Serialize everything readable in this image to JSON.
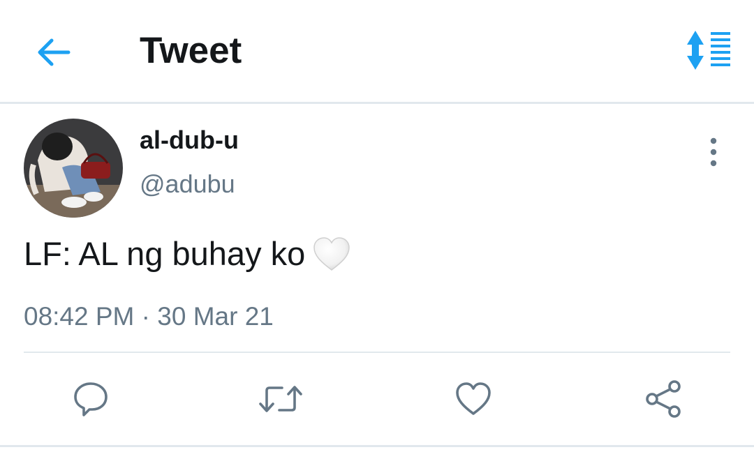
{
  "header": {
    "title": "Tweet",
    "back_icon": "arrow-left-icon",
    "sort_icon": "sort-list-icon",
    "accent_color": "#1da1f2"
  },
  "tweet": {
    "author": {
      "display_name": "al-dub-u",
      "handle": "@adubu",
      "avatar_icon": "avatar-photo"
    },
    "text": "LF: AL ng buhay ko",
    "emoji": "white-heart-emoji",
    "time": "08:42 PM",
    "separator": "·",
    "date": "30 Mar 21"
  },
  "actions": [
    {
      "name": "reply",
      "icon": "comment-icon"
    },
    {
      "name": "retweet",
      "icon": "retweet-icon"
    },
    {
      "name": "like",
      "icon": "heart-icon"
    },
    {
      "name": "share",
      "icon": "share-icon"
    }
  ],
  "colors": {
    "text_primary": "#14171a",
    "text_secondary": "#657786",
    "divider": "#e1e8ed",
    "icon_gray": "#657786"
  }
}
